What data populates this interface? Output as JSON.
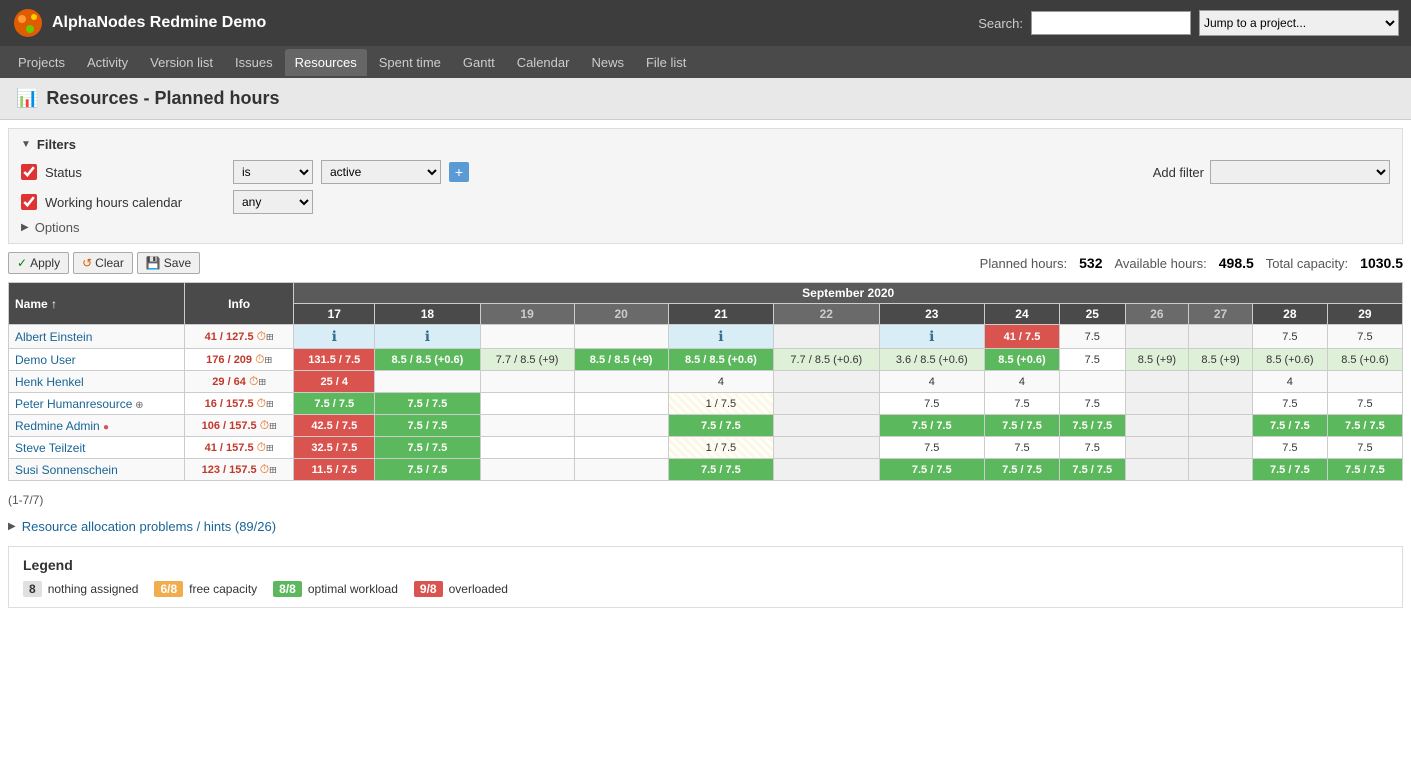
{
  "app": {
    "title": "AlphaNodes Redmine Demo",
    "search_label": "Search:",
    "search_placeholder": "",
    "jump_placeholder": "Jump to a project..."
  },
  "nav": {
    "items": [
      {
        "label": "Projects",
        "active": false
      },
      {
        "label": "Activity",
        "active": false
      },
      {
        "label": "Version list",
        "active": false
      },
      {
        "label": "Issues",
        "active": false
      },
      {
        "label": "Resources",
        "active": true
      },
      {
        "label": "Spent time",
        "active": false
      },
      {
        "label": "Gantt",
        "active": false
      },
      {
        "label": "Calendar",
        "active": false
      },
      {
        "label": "News",
        "active": false
      },
      {
        "label": "File list",
        "active": false
      }
    ]
  },
  "page": {
    "title": "Resources - Planned hours",
    "icon": "chart-icon"
  },
  "filters": {
    "header": "Filters",
    "status_label": "Status",
    "status_operator": "is",
    "status_value": "active",
    "working_hours_label": "Working hours calendar",
    "working_hours_value": "any",
    "add_filter_label": "Add filter",
    "options_label": "Options"
  },
  "actions": {
    "apply": "Apply",
    "clear": "Clear",
    "save": "Save"
  },
  "stats": {
    "planned_label": "Planned hours:",
    "planned_value": "532",
    "available_label": "Available hours:",
    "available_value": "498.5",
    "capacity_label": "Total capacity:",
    "capacity_value": "1030.5"
  },
  "table": {
    "month_header": "September 2020",
    "col_name": "Name",
    "col_info": "Info",
    "days": [
      "17",
      "18",
      "19",
      "20",
      "21",
      "22",
      "23",
      "24",
      "25",
      "26",
      "27",
      "28",
      "29"
    ],
    "rows": [
      {
        "name": "Albert Einstein",
        "hours_ratio": "41 / 127.5",
        "cells": {
          "17": {
            "val": "",
            "type": "blue-info"
          },
          "18": {
            "val": "",
            "type": "blue-info"
          },
          "19": {
            "val": "",
            "type": "normal"
          },
          "20": {
            "val": "",
            "type": "normal"
          },
          "21": {
            "val": "",
            "type": "blue-info"
          },
          "22": {
            "val": "",
            "type": "weekend"
          },
          "23": {
            "val": "",
            "type": "blue-info"
          },
          "24": {
            "val": "41 / 7.5",
            "type": "red"
          },
          "25": {
            "val": "7.5",
            "type": "normal"
          },
          "26": {
            "val": "",
            "type": "weekend"
          },
          "27": {
            "val": "",
            "type": "weekend"
          },
          "28": {
            "val": "7.5",
            "type": "normal"
          },
          "29": {
            "val": "7.5",
            "type": "normal"
          }
        }
      },
      {
        "name": "Demo User",
        "hours_ratio": "176 / 209",
        "cells": {
          "17": {
            "val": "131.5 / 7.5",
            "type": "red"
          },
          "18": {
            "val": "8.5 / 8.5 (+0.6)",
            "type": "green"
          },
          "19": {
            "val": "7.7 / 8.5 (+9)",
            "type": "light-green"
          },
          "20": {
            "val": "8.5 / 8.5 (+9)",
            "type": "green"
          },
          "21": {
            "val": "8.5 / 8.5 (+0.6)",
            "type": "green"
          },
          "22": {
            "val": "7.7 / 8.5 (+0.6)",
            "type": "light-green"
          },
          "23": {
            "val": "3.6 / 8.5 (+0.6)",
            "type": "light-green"
          },
          "24": {
            "val": "8.5 (+0.6)",
            "type": "green"
          },
          "25": {
            "val": "7.5",
            "type": "normal"
          },
          "26": {
            "val": "8.5 (+9)",
            "type": "light-green"
          },
          "27": {
            "val": "8.5 (+9)",
            "type": "light-green"
          },
          "28": {
            "val": "8.5 (+0.6)",
            "type": "light-green"
          },
          "29": {
            "val": "8.5 (+0.6)",
            "type": "light-green"
          }
        }
      },
      {
        "name": "Henk Henkel",
        "hours_ratio": "29 / 64",
        "cells": {
          "17": {
            "val": "25 / 4",
            "type": "red"
          },
          "18": {
            "val": "",
            "type": "normal"
          },
          "19": {
            "val": "",
            "type": "normal"
          },
          "20": {
            "val": "",
            "type": "normal"
          },
          "21": {
            "val": "4",
            "type": "normal"
          },
          "22": {
            "val": "",
            "type": "weekend"
          },
          "23": {
            "val": "4",
            "type": "normal"
          },
          "24": {
            "val": "4",
            "type": "normal"
          },
          "25": {
            "val": "",
            "type": "normal"
          },
          "26": {
            "val": "",
            "type": "weekend"
          },
          "27": {
            "val": "",
            "type": "weekend"
          },
          "28": {
            "val": "4",
            "type": "normal"
          },
          "29": {
            "val": "",
            "type": "normal"
          }
        }
      },
      {
        "name": "Peter Humanresource",
        "hours_ratio": "16 / 157.5",
        "has_icon": true,
        "cells": {
          "17": {
            "val": "7.5 / 7.5",
            "type": "green"
          },
          "18": {
            "val": "7.5 / 7.5",
            "type": "green"
          },
          "19": {
            "val": "",
            "type": "normal"
          },
          "20": {
            "val": "",
            "type": "normal"
          },
          "21": {
            "val": "1 / 7.5",
            "type": "striped"
          },
          "22": {
            "val": "",
            "type": "weekend"
          },
          "23": {
            "val": "7.5",
            "type": "normal"
          },
          "24": {
            "val": "7.5",
            "type": "normal"
          },
          "25": {
            "val": "7.5",
            "type": "normal"
          },
          "26": {
            "val": "",
            "type": "weekend"
          },
          "27": {
            "val": "",
            "type": "weekend"
          },
          "28": {
            "val": "7.5",
            "type": "normal"
          },
          "29": {
            "val": "7.5",
            "type": "normal"
          }
        }
      },
      {
        "name": "Redmine Admin",
        "hours_ratio": "106 / 157.5",
        "has_dot": true,
        "cells": {
          "17": {
            "val": "42.5 / 7.5",
            "type": "red"
          },
          "18": {
            "val": "7.5 / 7.5",
            "type": "green"
          },
          "19": {
            "val": "",
            "type": "normal"
          },
          "20": {
            "val": "",
            "type": "normal"
          },
          "21": {
            "val": "7.5 / 7.5",
            "type": "green"
          },
          "22": {
            "val": "",
            "type": "weekend"
          },
          "23": {
            "val": "7.5 / 7.5",
            "type": "green"
          },
          "24": {
            "val": "7.5 / 7.5",
            "type": "green"
          },
          "25": {
            "val": "7.5 / 7.5",
            "type": "green"
          },
          "26": {
            "val": "",
            "type": "weekend"
          },
          "27": {
            "val": "",
            "type": "weekend"
          },
          "28": {
            "val": "7.5 / 7.5",
            "type": "green"
          },
          "29": {
            "val": "7.5 / 7.5",
            "type": "green"
          }
        }
      },
      {
        "name": "Steve Teilzeit",
        "hours_ratio": "41 / 157.5",
        "cells": {
          "17": {
            "val": "32.5 / 7.5",
            "type": "red"
          },
          "18": {
            "val": "7.5 / 7.5",
            "type": "green"
          },
          "19": {
            "val": "",
            "type": "normal"
          },
          "20": {
            "val": "",
            "type": "normal"
          },
          "21": {
            "val": "1 / 7.5",
            "type": "striped"
          },
          "22": {
            "val": "",
            "type": "weekend"
          },
          "23": {
            "val": "7.5",
            "type": "normal"
          },
          "24": {
            "val": "7.5",
            "type": "normal"
          },
          "25": {
            "val": "7.5",
            "type": "normal"
          },
          "26": {
            "val": "",
            "type": "weekend"
          },
          "27": {
            "val": "",
            "type": "weekend"
          },
          "28": {
            "val": "7.5",
            "type": "normal"
          },
          "29": {
            "val": "7.5",
            "type": "normal"
          }
        }
      },
      {
        "name": "Susi Sonnenschein",
        "hours_ratio": "123 / 157.5",
        "cells": {
          "17": {
            "val": "11.5 / 7.5",
            "type": "red"
          },
          "18": {
            "val": "7.5 / 7.5",
            "type": "green"
          },
          "19": {
            "val": "",
            "type": "normal"
          },
          "20": {
            "val": "",
            "type": "normal"
          },
          "21": {
            "val": "7.5 / 7.5",
            "type": "green"
          },
          "22": {
            "val": "",
            "type": "weekend"
          },
          "23": {
            "val": "7.5 / 7.5",
            "type": "green"
          },
          "24": {
            "val": "7.5 / 7.5",
            "type": "green"
          },
          "25": {
            "val": "7.5 / 7.5",
            "type": "green"
          },
          "26": {
            "val": "",
            "type": "weekend"
          },
          "27": {
            "val": "",
            "type": "weekend"
          },
          "28": {
            "val": "7.5 / 7.5",
            "type": "green"
          },
          "29": {
            "val": "7.5 / 7.5",
            "type": "green"
          }
        }
      }
    ]
  },
  "pagination": "(1-7/7)",
  "problems": {
    "label": "Resource allocation problems / hints (89/26)"
  },
  "legend": {
    "title": "Legend",
    "items": [
      {
        "box_class": "gray",
        "box_label": "8",
        "description": "nothing assigned"
      },
      {
        "box_class": "yellow",
        "box_label": "6/8",
        "description": "free capacity"
      },
      {
        "box_class": "green",
        "box_label": "8/8",
        "description": "optimal workload"
      },
      {
        "box_class": "red",
        "box_label": "9/8",
        "description": "overloaded"
      }
    ]
  }
}
